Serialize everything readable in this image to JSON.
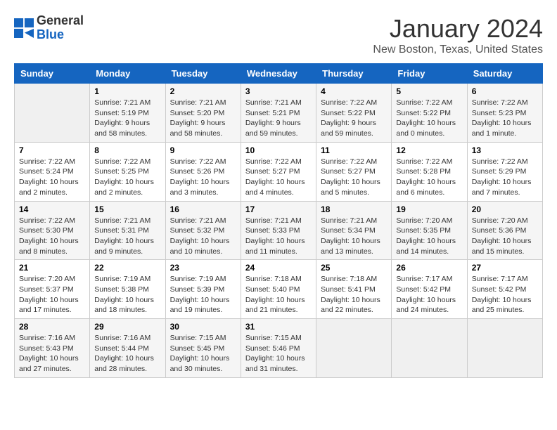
{
  "header": {
    "logo_general": "General",
    "logo_blue": "Blue",
    "month_title": "January 2024",
    "location": "New Boston, Texas, United States"
  },
  "days_of_week": [
    "Sunday",
    "Monday",
    "Tuesday",
    "Wednesday",
    "Thursday",
    "Friday",
    "Saturday"
  ],
  "weeks": [
    [
      {
        "day": "",
        "info": ""
      },
      {
        "day": "1",
        "info": "Sunrise: 7:21 AM\nSunset: 5:19 PM\nDaylight: 9 hours\nand 58 minutes."
      },
      {
        "day": "2",
        "info": "Sunrise: 7:21 AM\nSunset: 5:20 PM\nDaylight: 9 hours\nand 58 minutes."
      },
      {
        "day": "3",
        "info": "Sunrise: 7:21 AM\nSunset: 5:21 PM\nDaylight: 9 hours\nand 59 minutes."
      },
      {
        "day": "4",
        "info": "Sunrise: 7:22 AM\nSunset: 5:22 PM\nDaylight: 9 hours\nand 59 minutes."
      },
      {
        "day": "5",
        "info": "Sunrise: 7:22 AM\nSunset: 5:22 PM\nDaylight: 10 hours\nand 0 minutes."
      },
      {
        "day": "6",
        "info": "Sunrise: 7:22 AM\nSunset: 5:23 PM\nDaylight: 10 hours\nand 1 minute."
      }
    ],
    [
      {
        "day": "7",
        "info": "Sunrise: 7:22 AM\nSunset: 5:24 PM\nDaylight: 10 hours\nand 2 minutes."
      },
      {
        "day": "8",
        "info": "Sunrise: 7:22 AM\nSunset: 5:25 PM\nDaylight: 10 hours\nand 2 minutes."
      },
      {
        "day": "9",
        "info": "Sunrise: 7:22 AM\nSunset: 5:26 PM\nDaylight: 10 hours\nand 3 minutes."
      },
      {
        "day": "10",
        "info": "Sunrise: 7:22 AM\nSunset: 5:27 PM\nDaylight: 10 hours\nand 4 minutes."
      },
      {
        "day": "11",
        "info": "Sunrise: 7:22 AM\nSunset: 5:27 PM\nDaylight: 10 hours\nand 5 minutes."
      },
      {
        "day": "12",
        "info": "Sunrise: 7:22 AM\nSunset: 5:28 PM\nDaylight: 10 hours\nand 6 minutes."
      },
      {
        "day": "13",
        "info": "Sunrise: 7:22 AM\nSunset: 5:29 PM\nDaylight: 10 hours\nand 7 minutes."
      }
    ],
    [
      {
        "day": "14",
        "info": "Sunrise: 7:22 AM\nSunset: 5:30 PM\nDaylight: 10 hours\nand 8 minutes."
      },
      {
        "day": "15",
        "info": "Sunrise: 7:21 AM\nSunset: 5:31 PM\nDaylight: 10 hours\nand 9 minutes."
      },
      {
        "day": "16",
        "info": "Sunrise: 7:21 AM\nSunset: 5:32 PM\nDaylight: 10 hours\nand 10 minutes."
      },
      {
        "day": "17",
        "info": "Sunrise: 7:21 AM\nSunset: 5:33 PM\nDaylight: 10 hours\nand 11 minutes."
      },
      {
        "day": "18",
        "info": "Sunrise: 7:21 AM\nSunset: 5:34 PM\nDaylight: 10 hours\nand 13 minutes."
      },
      {
        "day": "19",
        "info": "Sunrise: 7:20 AM\nSunset: 5:35 PM\nDaylight: 10 hours\nand 14 minutes."
      },
      {
        "day": "20",
        "info": "Sunrise: 7:20 AM\nSunset: 5:36 PM\nDaylight: 10 hours\nand 15 minutes."
      }
    ],
    [
      {
        "day": "21",
        "info": "Sunrise: 7:20 AM\nSunset: 5:37 PM\nDaylight: 10 hours\nand 17 minutes."
      },
      {
        "day": "22",
        "info": "Sunrise: 7:19 AM\nSunset: 5:38 PM\nDaylight: 10 hours\nand 18 minutes."
      },
      {
        "day": "23",
        "info": "Sunrise: 7:19 AM\nSunset: 5:39 PM\nDaylight: 10 hours\nand 19 minutes."
      },
      {
        "day": "24",
        "info": "Sunrise: 7:18 AM\nSunset: 5:40 PM\nDaylight: 10 hours\nand 21 minutes."
      },
      {
        "day": "25",
        "info": "Sunrise: 7:18 AM\nSunset: 5:41 PM\nDaylight: 10 hours\nand 22 minutes."
      },
      {
        "day": "26",
        "info": "Sunrise: 7:17 AM\nSunset: 5:42 PM\nDaylight: 10 hours\nand 24 minutes."
      },
      {
        "day": "27",
        "info": "Sunrise: 7:17 AM\nSunset: 5:42 PM\nDaylight: 10 hours\nand 25 minutes."
      }
    ],
    [
      {
        "day": "28",
        "info": "Sunrise: 7:16 AM\nSunset: 5:43 PM\nDaylight: 10 hours\nand 27 minutes."
      },
      {
        "day": "29",
        "info": "Sunrise: 7:16 AM\nSunset: 5:44 PM\nDaylight: 10 hours\nand 28 minutes."
      },
      {
        "day": "30",
        "info": "Sunrise: 7:15 AM\nSunset: 5:45 PM\nDaylight: 10 hours\nand 30 minutes."
      },
      {
        "day": "31",
        "info": "Sunrise: 7:15 AM\nSunset: 5:46 PM\nDaylight: 10 hours\nand 31 minutes."
      },
      {
        "day": "",
        "info": ""
      },
      {
        "day": "",
        "info": ""
      },
      {
        "day": "",
        "info": ""
      }
    ]
  ]
}
